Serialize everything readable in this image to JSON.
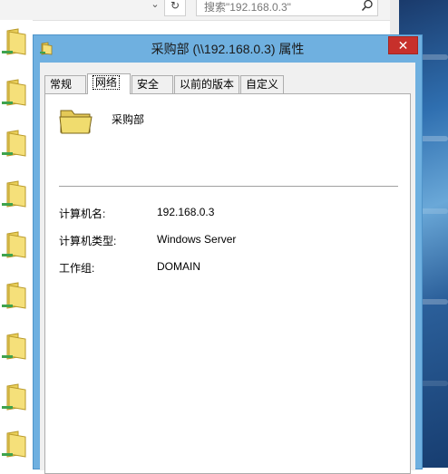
{
  "explorer": {
    "search_placeholder": "搜索\"192.168.0.3\""
  },
  "dialog": {
    "title": "采购部 (\\\\192.168.0.3) 属性",
    "close_symbol": "✕",
    "tabs": [
      {
        "label": "常规"
      },
      {
        "label": "网络"
      },
      {
        "label": "安全"
      },
      {
        "label": "以前的版本"
      },
      {
        "label": "自定义"
      }
    ],
    "active_tab": "网络",
    "folder_name": "采购部",
    "properties": [
      {
        "label": "计算机名:",
        "value": "192.168.0.3"
      },
      {
        "label": "计算机类型:",
        "value": "Windows Server"
      },
      {
        "label": "工作组:",
        "value": "DOMAIN"
      }
    ]
  },
  "colors": {
    "titlebar": "#6fb0e0",
    "close_button": "#c7302b",
    "folder": "#f0dc6e"
  }
}
